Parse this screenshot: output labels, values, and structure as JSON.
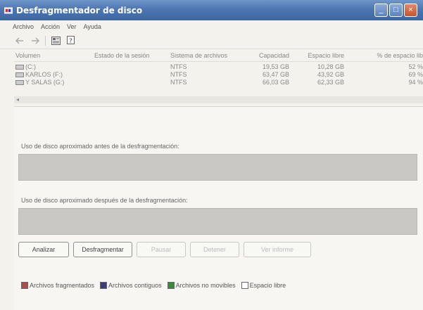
{
  "window": {
    "title": "Desfragmentador de disco"
  },
  "menu": [
    "Archivo",
    "Acción",
    "Ver",
    "Ayuda"
  ],
  "volumes": {
    "headers": [
      "Volumen",
      "Estado de la sesión",
      "Sistema de archivos",
      "Capacidad",
      "Espacio libre",
      "% de espacio lib"
    ],
    "rows": [
      {
        "name": "(C:)",
        "fs": "NTFS",
        "capacity": "19,53 GB",
        "free": "10,28 GB",
        "pct": "52 %"
      },
      {
        "name": "KARLOS (F:)",
        "fs": "NTFS",
        "capacity": "63,47 GB",
        "free": "43,92 GB",
        "pct": "69 %"
      },
      {
        "name": "Y SALAS (G:)",
        "fs": "NTFS",
        "capacity": "66,03 GB",
        "free": "62,33 GB",
        "pct": "94 %"
      }
    ]
  },
  "analysis": {
    "before_label": "Uso de disco aproximado antes de la desfragmentación:",
    "after_label": "Uso de disco aproximado después de la desfragmentación:"
  },
  "buttons": {
    "analyze": "Analizar",
    "defrag": "Desfragmentar",
    "pause": "Pausar",
    "stop": "Detener",
    "report": "Ver informe"
  },
  "legend": [
    {
      "label": "Archivos fragmentados",
      "color": "#a94f4f"
    },
    {
      "label": "Archivos contiguos",
      "color": "#3b3f78"
    },
    {
      "label": "Archivos no movibles",
      "color": "#3a8a3a"
    },
    {
      "label": "Espacio libre",
      "color": "#ffffff"
    }
  ],
  "colors": {
    "titlebar": "#4d76b2",
    "panel_bar": "#c9c8c4"
  },
  "icons": {
    "window": "defrag-icon",
    "toolbar": [
      "back-arrow-icon",
      "forward-arrow-icon",
      "properties-icon",
      "help-icon"
    ],
    "drive": "drive-icon"
  }
}
